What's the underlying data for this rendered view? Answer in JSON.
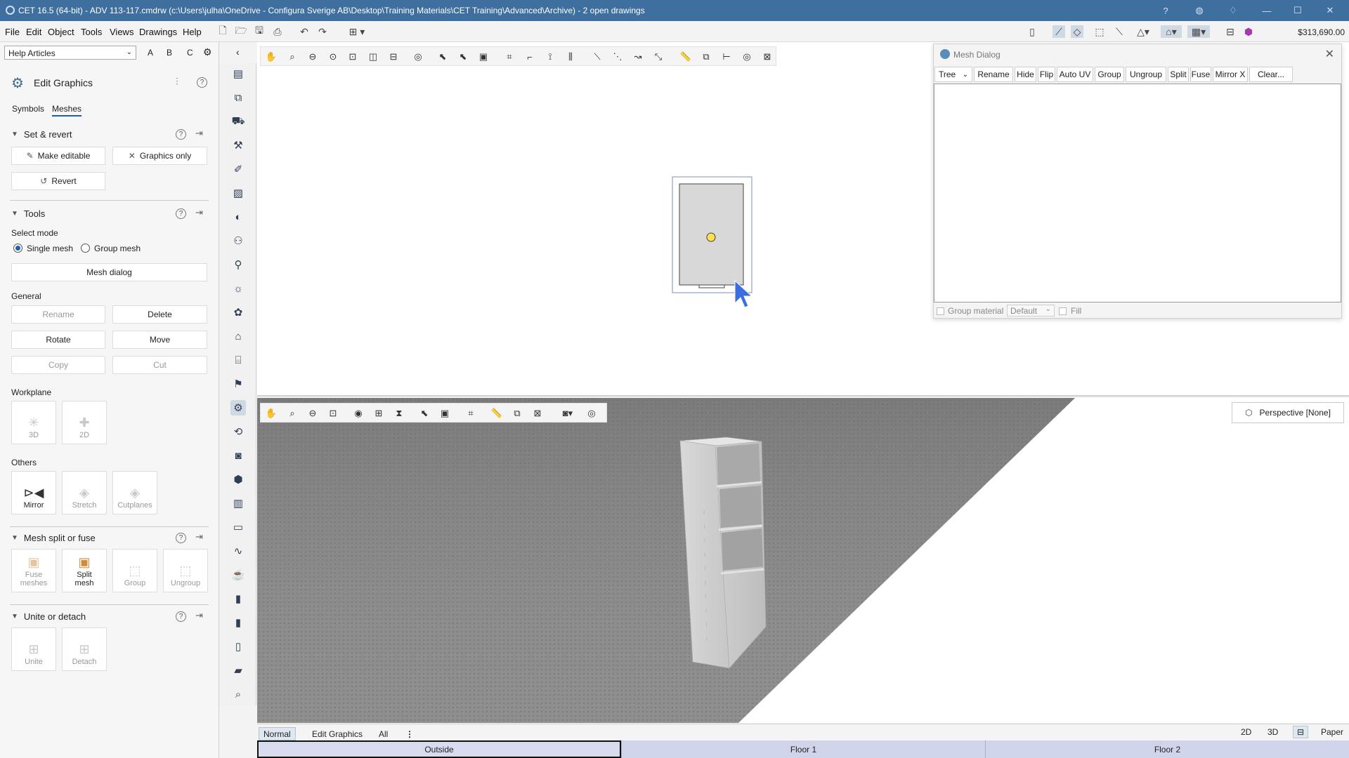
{
  "titlebar": {
    "title": "CET 16.5 (64-bit) - ADV 113-117.cmdrw (c:\\Users\\julha\\OneDrive - Configura Sverige AB\\Desktop\\Training Materials\\CET Training\\Advanced\\Archive) - 2  open drawings",
    "icons": [
      "help-icon",
      "globe-icon",
      "bell-icon",
      "minimize-icon",
      "maximize-icon",
      "close-icon"
    ]
  },
  "menubar": {
    "items": [
      "File",
      "Edit",
      "Object",
      "Tools",
      "Views",
      "Drawings",
      "Help"
    ],
    "price": "$313,690.00"
  },
  "leftpanel": {
    "help_select": "Help Articles",
    "abc": [
      "A",
      "B",
      "C"
    ],
    "header_title": "Edit Graphics",
    "tabs": [
      "Symbols",
      "Meshes"
    ],
    "set_revert": {
      "title": "Set & revert",
      "make_editable": "Make editable",
      "graphics_only": "Graphics only",
      "revert": "Revert"
    },
    "tools": {
      "title": "Tools",
      "select_mode_label": "Select mode",
      "single_mesh": "Single mesh",
      "group_mesh": "Group mesh",
      "mesh_dialog": "Mesh dialog",
      "general_label": "General",
      "rename": "Rename",
      "delete": "Delete",
      "rotate": "Rotate",
      "move": "Move",
      "copy": "Copy",
      "cut": "Cut",
      "workplane_label": "Workplane",
      "wp_3d": "3D",
      "wp_2d": "2D",
      "others_label": "Others",
      "mirror": "Mirror",
      "stretch": "Stretch",
      "cutplanes": "Cutplanes"
    },
    "mesh_split": {
      "title": "Mesh split or fuse",
      "fuse_1": "Fuse",
      "fuse_2": "meshes",
      "split_1": "Split",
      "split_2": "mesh",
      "group": "Group",
      "ungroup": "Ungroup"
    },
    "unite_detach": {
      "title": "Unite or detach",
      "unite": "Unite",
      "detach": "Detach"
    }
  },
  "mesh_dialog": {
    "title": "Mesh Dialog",
    "tree_select": "Tree",
    "buttons": [
      "Rename",
      "Hide",
      "Flip",
      "Auto UV",
      "Group",
      "Ungroup",
      "Split",
      "Fuse",
      "Mirror X",
      "Clear..."
    ],
    "group_material": "Group material",
    "material_select": "Default",
    "fill": "Fill"
  },
  "view3d": {
    "perspective": "Perspective [None]"
  },
  "modebar": {
    "tabs": [
      "Normal",
      "Edit Graphics",
      "All"
    ],
    "view_buttons": [
      "2D",
      "3D",
      "Paper"
    ]
  },
  "floorbar": {
    "floors": [
      "Outside",
      "Floor 1",
      "Floor 2"
    ]
  },
  "colors": {
    "titlebar": "#3f6f9e",
    "accent": "#1a5fb4",
    "floorbar": "#cfd4ea"
  }
}
